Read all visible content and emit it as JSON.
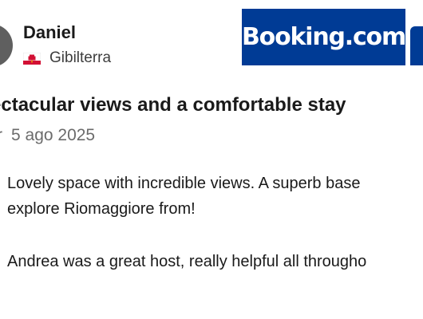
{
  "reviewer": {
    "name": "Daniel",
    "country": "Gibilterra"
  },
  "brand": {
    "logo_text": "Booking.com",
    "color": "#003b95"
  },
  "review": {
    "title": "ectacular views and a comfortable stay",
    "date_prefix": "r",
    "date": "5 ago 2025",
    "paragraph_1_line_1": "Lovely space with incredible views. A superb base",
    "paragraph_1_line_2": "explore Riomaggiore from!",
    "paragraph_2": "Andrea was a great host, really helpful all througho"
  },
  "colors": {
    "avatar": "#5f5f5f",
    "flag_red": "#d21034",
    "text_primary": "#1a1a1a",
    "text_secondary": "#6b6b6b"
  }
}
